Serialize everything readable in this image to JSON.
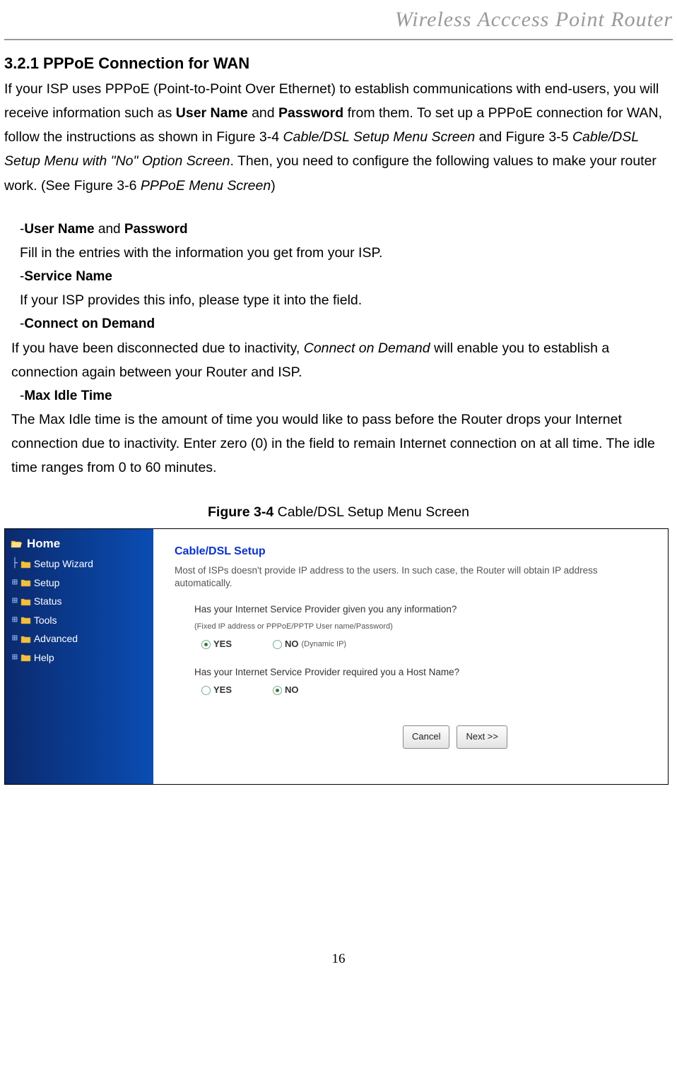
{
  "header": {
    "title": "Wireless  Acccess  Point  Router"
  },
  "section": {
    "heading": "3.2.1 PPPoE Connection for WAN",
    "p1a": "If your ISP uses PPPoE (Point-to-Point Over Ethernet) to establish communications with end-users, you will receive information such as ",
    "p1b": "User Name",
    "p1c": " and ",
    "p1d": "Password",
    "p1e": " from them. To set up a PPPoE connection for WAN, follow the instructions as shown in Figure 3-4 ",
    "p1f": "Cable/DSL Setup Menu Screen",
    "p1g": " and Figure 3-5 ",
    "p1h": "Cable/DSL Setup Menu with \"No\" Option Screen",
    "p1i": ". Then, you need to configure the following values to make your router work. (See Figure 3-6 ",
    "p1j": "PPPoE Menu Screen",
    "p1k": ")"
  },
  "list": {
    "i1_dash": "-",
    "i1_b1": "User Name",
    "i1_mid": " and ",
    "i1_b2": "Password",
    "i1_body": "Fill in the entries with the information you get from your ISP.",
    "i2_dash": "-",
    "i2_head": "Service Name",
    "i2_body": "If your ISP provides this info, please type it into the field.",
    "i3_dash": "-",
    "i3_head": "Connect on Demand",
    "i3_body_a": "If you have been disconnected due to inactivity, ",
    "i3_body_b": "Connect on Demand",
    "i3_body_c": " will enable you to establish a connection again between your Router and ISP.",
    "i4_dash": "-",
    "i4_head": "Max Idle Time",
    "i4_body": "The Max Idle time is the amount of time you would like to pass before the Router drops your Internet connection due to inactivity. Enter zero (0) in the field to remain Internet connection on at all time. The idle time ranges from 0 to 60 minutes."
  },
  "figure": {
    "caption_b": "Figure 3-4",
    "caption_rest": " Cable/DSL Setup Menu Screen"
  },
  "sidebar": {
    "home": "Home",
    "items": [
      "Setup Wizard",
      "Setup",
      "Status",
      "Tools",
      "Advanced",
      "Help"
    ]
  },
  "panel": {
    "title": "Cable/DSL Setup",
    "desc": "Most of ISPs doesn't provide IP address to the users. In such case, the Router will obtain IP address automatically.",
    "q1": "Has your Internet Service Provider given you any information?",
    "q1_sub": "(Fixed IP address or PPPoE/PPTP User name/Password)",
    "q2": "Has your Internet Service Provider required  you a Host Name?",
    "yes": "YES",
    "no": "NO",
    "no_sub": "(Dynamic IP)",
    "cancel": "Cancel",
    "next": "Next >>"
  },
  "page_number": "16"
}
